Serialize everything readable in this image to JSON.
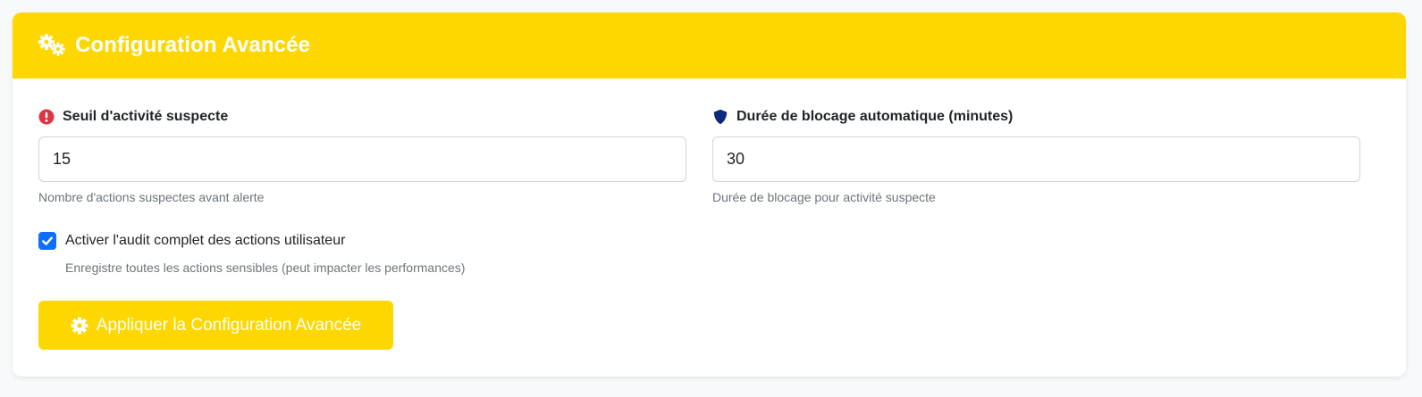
{
  "header": {
    "title": "Configuration Avancée",
    "icon": "cogs-icon",
    "background_color": "#ffd700"
  },
  "fields": {
    "suspicious_threshold": {
      "label": "Seuil d'activité suspecte",
      "icon": "exclamation-circle-icon",
      "icon_color": "#dc3545",
      "value": "15",
      "help": "Nombre d'actions suspectes avant alerte"
    },
    "block_duration": {
      "label": "Durée de blocage automatique (minutes)",
      "icon": "shield-icon",
      "icon_color": "#0b2a7a",
      "value": "30",
      "help": "Durée de blocage pour activité suspecte"
    }
  },
  "audit": {
    "checked": true,
    "label": "Activer l'audit complet des actions utilisateur",
    "help": "Enregistre toutes les actions sensibles (peut impacter les performances)",
    "checkbox_color": "#0d6efd"
  },
  "apply_button": {
    "label": "Appliquer la Configuration Avancée",
    "icon": "cog-icon",
    "color": "#ffd700"
  }
}
